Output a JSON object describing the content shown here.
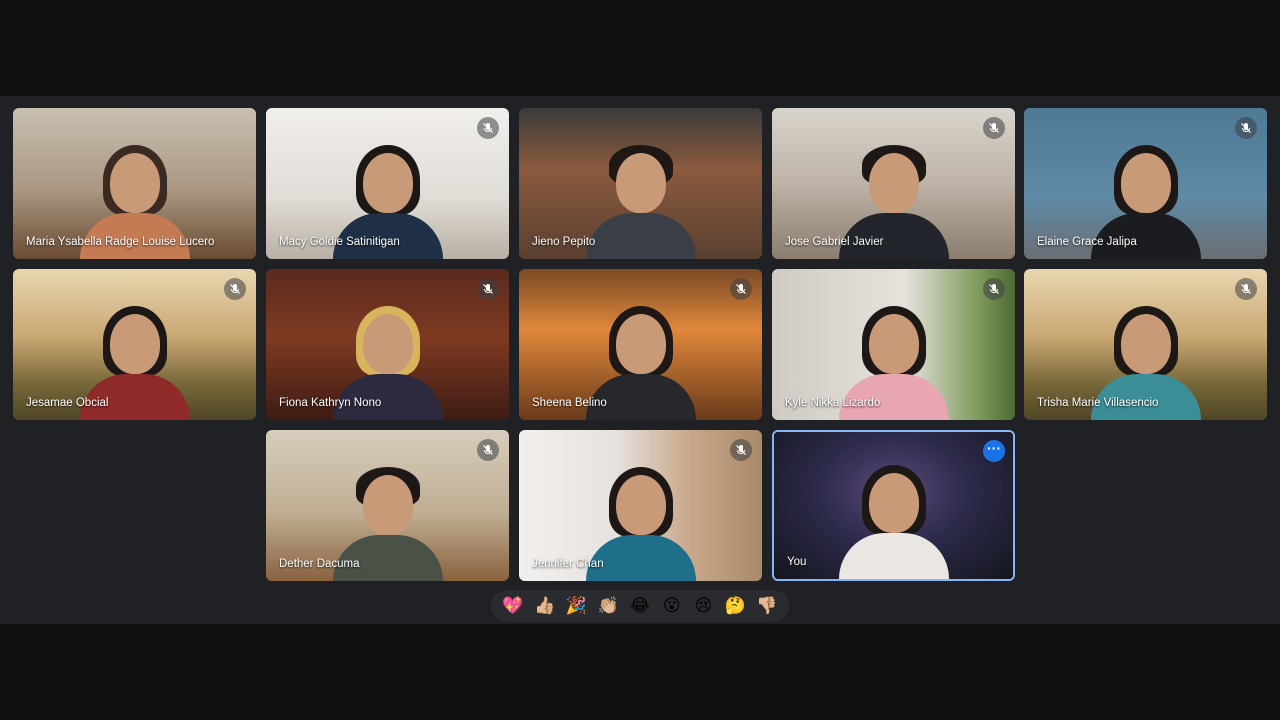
{
  "participants": [
    {
      "name": "Maria Ysabella Radge Louise Lucero",
      "muted": false
    },
    {
      "name": "Macy Goldie Satinitigan",
      "muted": true
    },
    {
      "name": "Jieno Pepito",
      "muted": false
    },
    {
      "name": "Jose Gabriel Javier",
      "muted": true
    },
    {
      "name": "Elaine Grace Jalipa",
      "muted": true
    },
    {
      "name": "Jesamae Obcial",
      "muted": true
    },
    {
      "name": "Fiona Kathryn Nono",
      "muted": true
    },
    {
      "name": "Sheena Belino",
      "muted": true
    },
    {
      "name": "Kyle Nikka Lizardo",
      "muted": true
    },
    {
      "name": "Trisha Marie Villasencio",
      "muted": true
    },
    {
      "name": "Dether Dacuma",
      "muted": true
    },
    {
      "name": "Jennifer Chan",
      "muted": true
    },
    {
      "name": "You",
      "muted": false
    }
  ],
  "self_tile": {
    "more_icon": "more-options-icon",
    "accent": "#8ab4f8"
  },
  "reactions": [
    {
      "icon": "sparkling-heart",
      "glyph": "💖"
    },
    {
      "icon": "thumbs-up",
      "glyph": "👍🏼"
    },
    {
      "icon": "party-popper",
      "glyph": "🎉"
    },
    {
      "icon": "clapping-hands",
      "glyph": "👏🏼"
    },
    {
      "icon": "tears-of-joy",
      "glyph": "😂"
    },
    {
      "icon": "surprised-face",
      "glyph": "😮"
    },
    {
      "icon": "sad-face",
      "glyph": "😢"
    },
    {
      "icon": "thinking-face",
      "glyph": "🤔"
    },
    {
      "icon": "thumbs-down",
      "glyph": "👎🏼"
    }
  ],
  "colors": {
    "page_bg": "#0e0f11",
    "stage_bg": "#202124",
    "tile_border_self": "#8ab4f8",
    "more_button": "#1a73e8"
  }
}
